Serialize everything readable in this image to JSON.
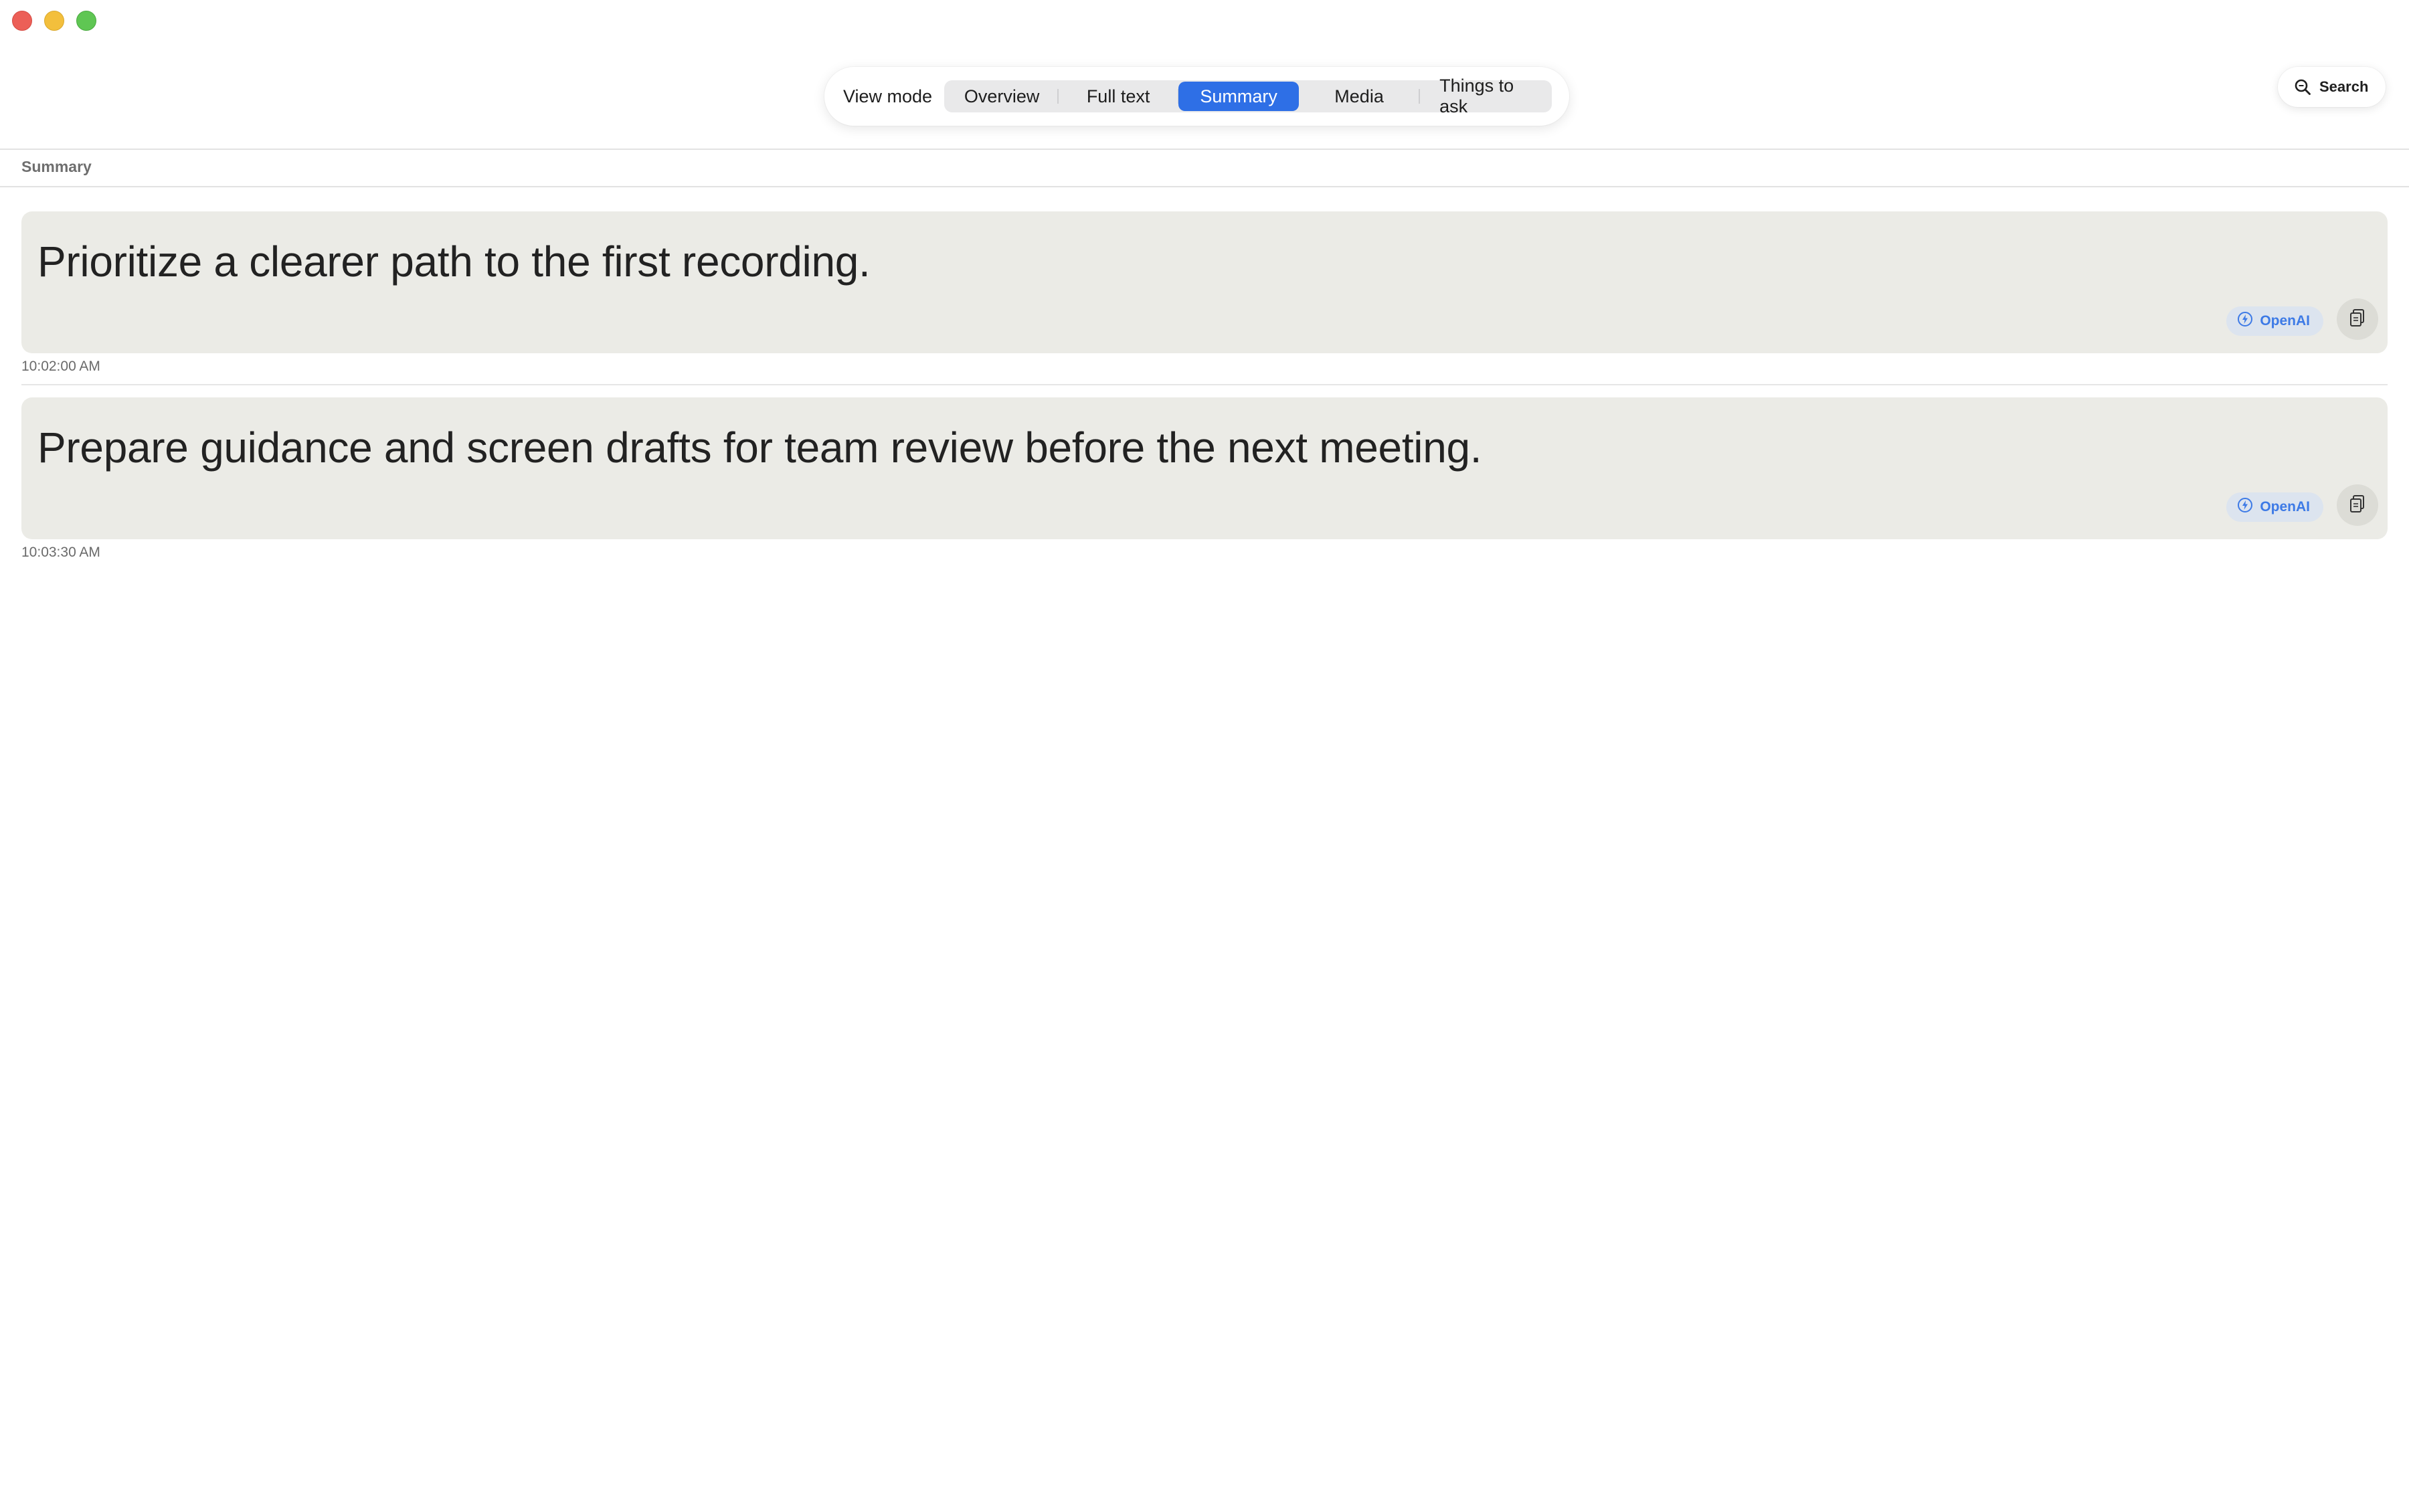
{
  "window": {
    "controls": [
      "close",
      "minimize",
      "maximize"
    ]
  },
  "toolbar": {
    "view_mode_label": "View mode",
    "tabs": [
      {
        "label": "Overview",
        "selected": false
      },
      {
        "label": "Full text",
        "selected": false
      },
      {
        "label": "Summary",
        "selected": true
      },
      {
        "label": "Media",
        "selected": false
      },
      {
        "label": "Things to ask",
        "selected": false
      }
    ],
    "search_label": "Search",
    "search_icon": "magnifier-icon"
  },
  "section": {
    "title": "Summary"
  },
  "summaries": [
    {
      "text": "Prioritize a clearer path to the first recording.",
      "provider": "OpenAI",
      "provider_icon": "bolt-circle-icon",
      "copy_icon": "copy-icon",
      "timestamp": "10:02:00 AM"
    },
    {
      "text": "Prepare guidance and screen drafts for team review before the next meeting.",
      "provider": "OpenAI",
      "provider_icon": "bolt-circle-icon",
      "copy_icon": "copy-icon",
      "timestamp": "10:03:30 AM"
    }
  ],
  "colors": {
    "accent": "#2e6fe6",
    "card_background": "#ebebe6",
    "badge_background": "#dce4ef",
    "badge_text": "#3d7ae6",
    "close": "#ec5f57",
    "minimize": "#f3bf3c",
    "maximize": "#5fc653"
  }
}
